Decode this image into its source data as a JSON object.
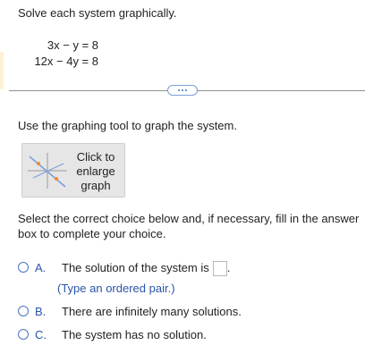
{
  "question": {
    "prompt": "Solve each system graphically.",
    "equations": [
      "3x − y = 8",
      "12x − 4y = 8"
    ]
  },
  "instruction": "Use the graphing tool to graph the system.",
  "graph_button": {
    "lines": [
      "Click to",
      "enlarge",
      "graph"
    ]
  },
  "select_instruction": "Select the correct choice below and, if necessary, fill in the answer box to complete your choice.",
  "choices": [
    {
      "letter": "A.",
      "text": "The solution of the system is",
      "hint": "(Type an ordered pair.)",
      "answer_value": "",
      "trailing": "."
    },
    {
      "letter": "B.",
      "text": "There are infinitely many solutions."
    },
    {
      "letter": "C.",
      "text": "The system has no solution."
    }
  ],
  "colors": {
    "accent": "#2a55a8",
    "radio_border": "#4a76c1",
    "divider": "#8f8f8f",
    "graph_line": "#7a9fd6",
    "graph_point": "#f08a2c"
  }
}
